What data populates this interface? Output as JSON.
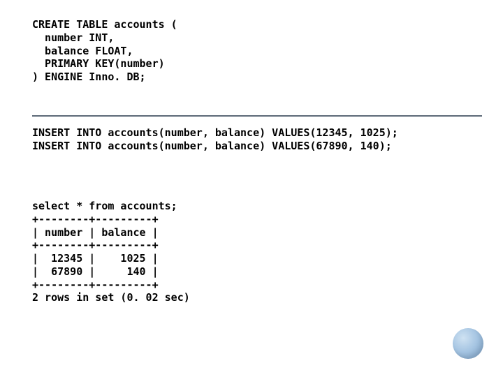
{
  "sql": {
    "create": "CREATE TABLE accounts (\n  number INT,\n  balance FLOAT,\n  PRIMARY KEY(number)\n) ENGINE Inno. DB;",
    "inserts": "INSERT INTO accounts(number, balance) VALUES(12345, 1025);\nINSERT INTO accounts(number, balance) VALUES(67890, 140);",
    "select": "select * from accounts;\n+--------+---------+\n| number | balance |\n+--------+---------+\n|  12345 |    1025 |\n|  67890 |     140 |\n+--------+---------+\n2 rows in set (0. 02 sec)"
  },
  "chart_data": {
    "type": "table",
    "title": "select * from accounts",
    "columns": [
      "number",
      "balance"
    ],
    "rows": [
      {
        "number": 12345,
        "balance": 1025
      },
      {
        "number": 67890,
        "balance": 140
      }
    ],
    "row_count": 2,
    "elapsed_sec": 0.02
  }
}
